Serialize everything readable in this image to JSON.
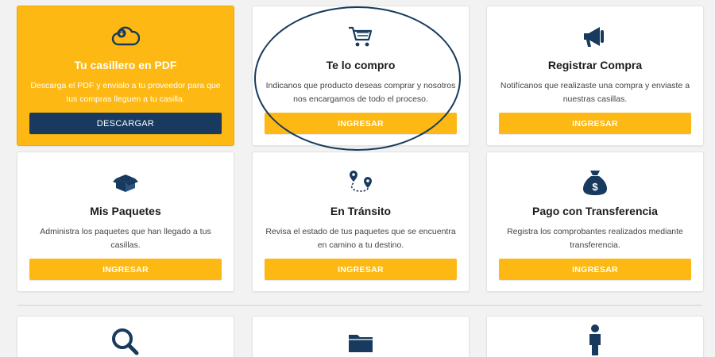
{
  "colors": {
    "accent": "#fdb813",
    "navy": "#173a5e",
    "card_bg": "#ffffff",
    "page_bg": "#f2f2f2"
  },
  "cards": [
    {
      "icon": "cloud-download-icon",
      "title": "Tu casillero en PDF",
      "description": "Descarga el PDF y envialo a tu proveedor para que tus compras lleguen a tu casilla.",
      "button": "DESCARGAR"
    },
    {
      "icon": "shopping-cart-icon",
      "title": "Te lo compro",
      "description": "Indicanos que producto deseas comprar y nosotros nos encargamos de todo el proceso.",
      "button": "INGRESAR"
    },
    {
      "icon": "megaphone-icon",
      "title": "Registrar Compra",
      "description": "Notifícanos que realizaste una compra y enviaste a nuestras casillas.",
      "button": "INGRESAR"
    },
    {
      "icon": "open-box-icon",
      "title": "Mis Paquetes",
      "description": "Administra los paquetes que han llegado a tus casillas.",
      "button": "INGRESAR"
    },
    {
      "icon": "route-map-pin-icon",
      "title": "En Tránsito",
      "description": "Revisa el estado de tus paquetes que se encuentra en camino a tu destino.",
      "button": "INGRESAR"
    },
    {
      "icon": "money-bag-icon",
      "title": "Pago con Transferencia",
      "description": "Registra los comprobantes realizados mediante transferencia.",
      "button": "INGRESAR"
    },
    {
      "icon": "search-icon"
    },
    {
      "icon": "folder-icon"
    },
    {
      "icon": "person-icon"
    }
  ]
}
